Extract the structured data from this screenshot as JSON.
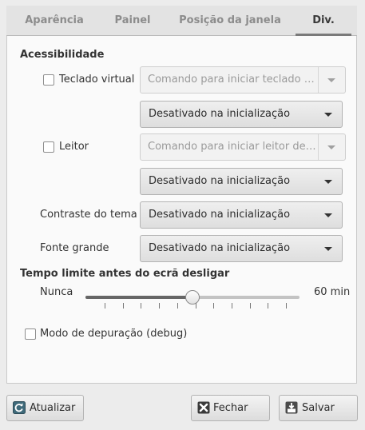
{
  "tabs": [
    {
      "label": "Aparência"
    },
    {
      "label": "Painel"
    },
    {
      "label": "Posição da janela"
    },
    {
      "label": "Div."
    }
  ],
  "active_tab": "Div.",
  "accessibility": {
    "title": "Acessibilidade",
    "virtual_keyboard": {
      "label": "Teclado virtual",
      "checked": false,
      "command_placeholder": "Comando para iniciar teclado vi...",
      "mode": "Desativado na inicialização"
    },
    "screen_reader": {
      "label": "Leitor",
      "checked": false,
      "command_placeholder": "Comando para iniciar leitor de t...",
      "mode": "Desativado na inicialização"
    },
    "theme_contrast": {
      "label": "Contraste do tema",
      "mode": "Desativado na inicialização"
    },
    "large_font": {
      "label": "Fonte grande",
      "mode": "Desativado na inicialização"
    }
  },
  "screen_timeout": {
    "title": "Tempo limite antes do ecrã desligar",
    "min_label": "Nunca",
    "max_label": "60 min",
    "value_fraction": 0.5,
    "tick_count": 11
  },
  "debug": {
    "label": "Modo de depuração (debug)",
    "checked": false
  },
  "buttons": {
    "refresh": "Atualizar",
    "close": "Fechar",
    "save": "Salvar"
  },
  "icons": {
    "refresh": "refresh-icon",
    "close": "close-icon",
    "save": "save-icon"
  }
}
